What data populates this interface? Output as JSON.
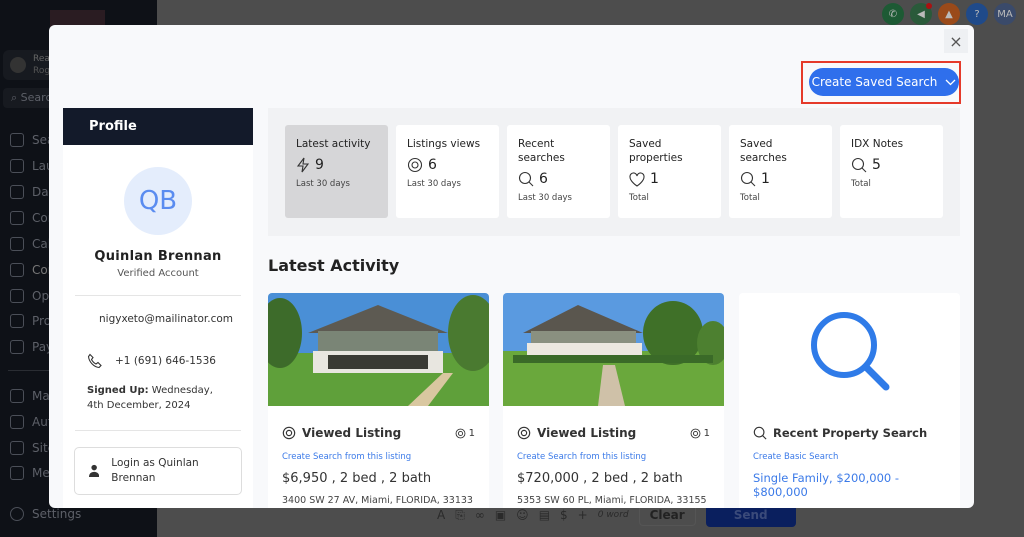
{
  "background": {
    "sidebar": {
      "account_name": "Real",
      "account_sub": "Roge",
      "search_placeholder": "Search",
      "items": [
        "Seas",
        "Laun",
        "Dash",
        "Conv",
        "Cale",
        "Cont",
        "Oppo",
        "Prop",
        "Paym",
        "Mark",
        "Auto",
        "Sites",
        "Mem",
        "Settings"
      ]
    },
    "topbar": {
      "avatar_initials": "MA",
      "help": "?"
    },
    "composer": {
      "word_count": "0 word",
      "clear_label": "Clear",
      "send_label": "Send"
    }
  },
  "modal": {
    "close_label": "×",
    "create_saved_search_label": "Create Saved Search",
    "profile": {
      "header": "Profile",
      "initials": "QB",
      "name": "Quinlan Brennan",
      "status": "Verified Account",
      "email": "nigyxeto@mailinator.com",
      "phone": "+1 (691) 646-1536",
      "signed_up_label": "Signed Up:",
      "signed_up_value": "Wednesday, 4th December, 2024",
      "login_as": "Login as Quinlan Brennan"
    },
    "stats": [
      {
        "title": "Latest activity",
        "icon": "lightning-icon",
        "value": "9",
        "sub": "Last 30 days",
        "active": true
      },
      {
        "title": "Listings views",
        "icon": "eye-icon",
        "value": "6",
        "sub": "Last 30 days"
      },
      {
        "title": "Recent searches",
        "icon": "search-icon",
        "value": "6",
        "sub": "Last 30 days"
      },
      {
        "title": "Saved properties",
        "icon": "heart-icon",
        "value": "1",
        "sub": "Total"
      },
      {
        "title": "Saved searches",
        "icon": "search-icon",
        "value": "1",
        "sub": "Total"
      },
      {
        "title": "IDX Notes",
        "icon": "search-icon",
        "value": "5",
        "sub": "Total"
      }
    ],
    "latest_activity_heading": "Latest Activity",
    "activity": [
      {
        "type": "Viewed Listing",
        "count": "1",
        "link": "Create Search from this listing",
        "summary": "$6,950 , 2 bed , 2 bath",
        "address": "3400 SW 27 AV, Miami, FLORIDA, 33133"
      },
      {
        "type": "Viewed Listing",
        "count": "1",
        "link": "Create Search from this listing",
        "summary": "$720,000 , 2 bed , 2 bath",
        "address": "5353 SW 60 PL, Miami, FLORIDA, 33155"
      },
      {
        "type": "Recent Property Search",
        "link": "Create Basic Search",
        "summary": "Single Family, $200,000 - $800,000"
      }
    ],
    "colors": {
      "accent": "#2f6fec",
      "link": "#3b7ae8",
      "highlight": "#e53a2a",
      "profile_header": "#131a2a"
    }
  }
}
